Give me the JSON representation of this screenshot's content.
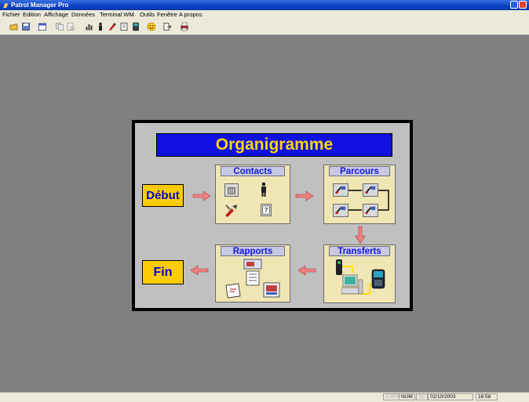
{
  "window": {
    "title": "Patrol Manager Pro"
  },
  "menu": [
    "Fichier",
    "Edition",
    "Affichage",
    "Données",
    "Terminal WM",
    "Outils",
    "Fenêtre",
    "A propos"
  ],
  "toolbar": [
    "open-icon",
    "save-icon",
    "calendar-icon",
    "copy-icon",
    "preview-icon",
    "chart-icon",
    "person-icon",
    "reader-icon",
    "document-icon",
    "terminal-icon",
    "smiley-icon",
    "exit-icon",
    "printer-icon"
  ],
  "organigramme": {
    "title": "Organigramme",
    "debut_label": "Début",
    "fin_label": "Fin",
    "contacts": {
      "title": "Contacts",
      "icons": [
        "building-icon",
        "guard-icon",
        "tools-icon",
        "contact-card-icon"
      ]
    },
    "parcours": {
      "title": "Parcours",
      "icons": [
        "checkpoint-icon",
        "checkpoint-icon",
        "checkpoint-icon",
        "checkpoint-icon"
      ]
    },
    "transferts": {
      "title": "Transferts",
      "icons": [
        "reader-pen-icon",
        "computer-icon",
        "handheld-terminal-icon"
      ]
    },
    "rapports": {
      "title": "Rapports",
      "icons": [
        "report-icon",
        "report-icon",
        "report-icon",
        "report-icon"
      ]
    },
    "colors": {
      "title_bg": "#1010e0",
      "title_text": "#ffd700",
      "panel_bg": "#efe6b4",
      "label_bg": "#ffcc00",
      "arrow": "#f08080"
    }
  },
  "status": {
    "caps": "CAPS",
    "num": "NUM",
    "scrl": "SC",
    "date": "02/10/2003",
    "time": "16:58"
  }
}
